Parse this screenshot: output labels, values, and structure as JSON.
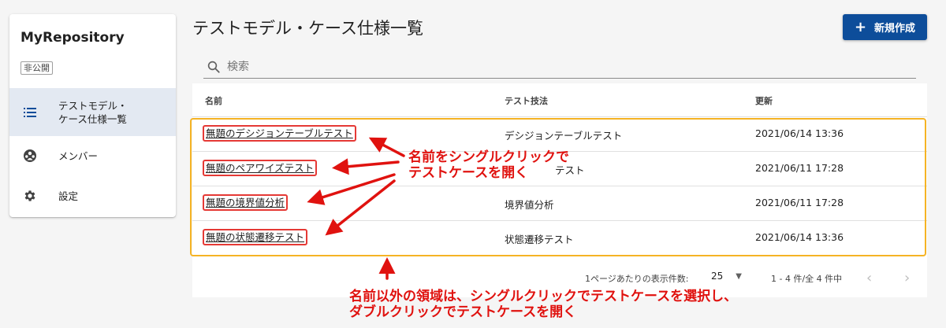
{
  "sidebar": {
    "repo_name": "MyRepository",
    "visibility": "非公開",
    "items": [
      {
        "icon": "list-icon",
        "label_line1": "テストモデル・",
        "label_line2": "ケース仕様一覧"
      },
      {
        "icon": "group-icon",
        "label": "メンバー"
      },
      {
        "icon": "gear-icon",
        "label": "設定"
      }
    ]
  },
  "header": {
    "title": "テストモデル・ケース仕様一覧",
    "new_button_label": "新規作成"
  },
  "search": {
    "placeholder": "検索"
  },
  "table": {
    "columns": [
      "名前",
      "テスト技法",
      "更新"
    ],
    "rows": [
      {
        "name": "無題のデシジョンテーブルテスト",
        "method": "デシジョンテーブルテスト",
        "updated": "2021/06/14 13:36"
      },
      {
        "name": "無題のペアワイズテスト",
        "method": "テスト",
        "updated": "2021/06/11 17:28"
      },
      {
        "name": "無題の境界値分析",
        "method": "境界値分析",
        "updated": "2021/06/11 17:28"
      },
      {
        "name": "無題の状態遷移テスト",
        "method": "状態遷移テスト",
        "updated": "2021/06/14 13:36"
      }
    ]
  },
  "pagination": {
    "rows_per_page_label": "1ページあたりの表示件数:",
    "rows_per_page": "25",
    "range": "1 - 4 件/全 4 件中"
  },
  "annotations": {
    "name_click_line1": "名前をシングルクリックで",
    "name_click_line2": "テストケースを開く",
    "area_click_line1": "名前以外の領域は、シングルクリックでテストケースを選択し、",
    "area_click_line2": "ダブルクリックでテストケースを開く"
  },
  "colors": {
    "accent": "#0d4d9a",
    "annotation": "#e0120f",
    "highlight": "#f5b324"
  }
}
